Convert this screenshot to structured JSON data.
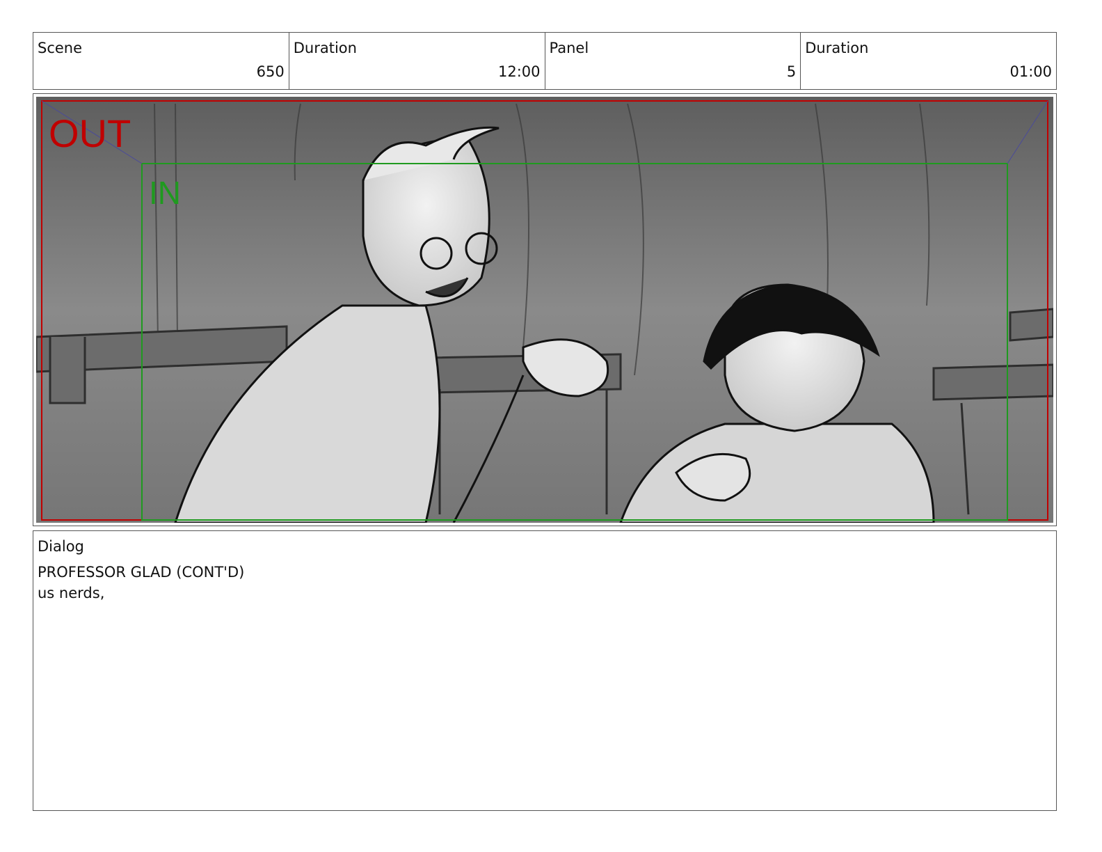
{
  "header": {
    "scene_label": "Scene",
    "scene_value": "650",
    "scene_duration_label": "Duration",
    "scene_duration_value": "12:00",
    "panel_label": "Panel",
    "panel_value": "5",
    "panel_duration_label": "Duration",
    "panel_duration_value": "01:00"
  },
  "frame_guides": {
    "out_label": "OUT",
    "in_label": "IN",
    "out_color": "#c00000",
    "in_color": "#1f9a1f"
  },
  "dialog": {
    "label": "Dialog",
    "line1": "PROFESSOR GLAD (CONT'D)",
    "line2": "us nerds,"
  }
}
